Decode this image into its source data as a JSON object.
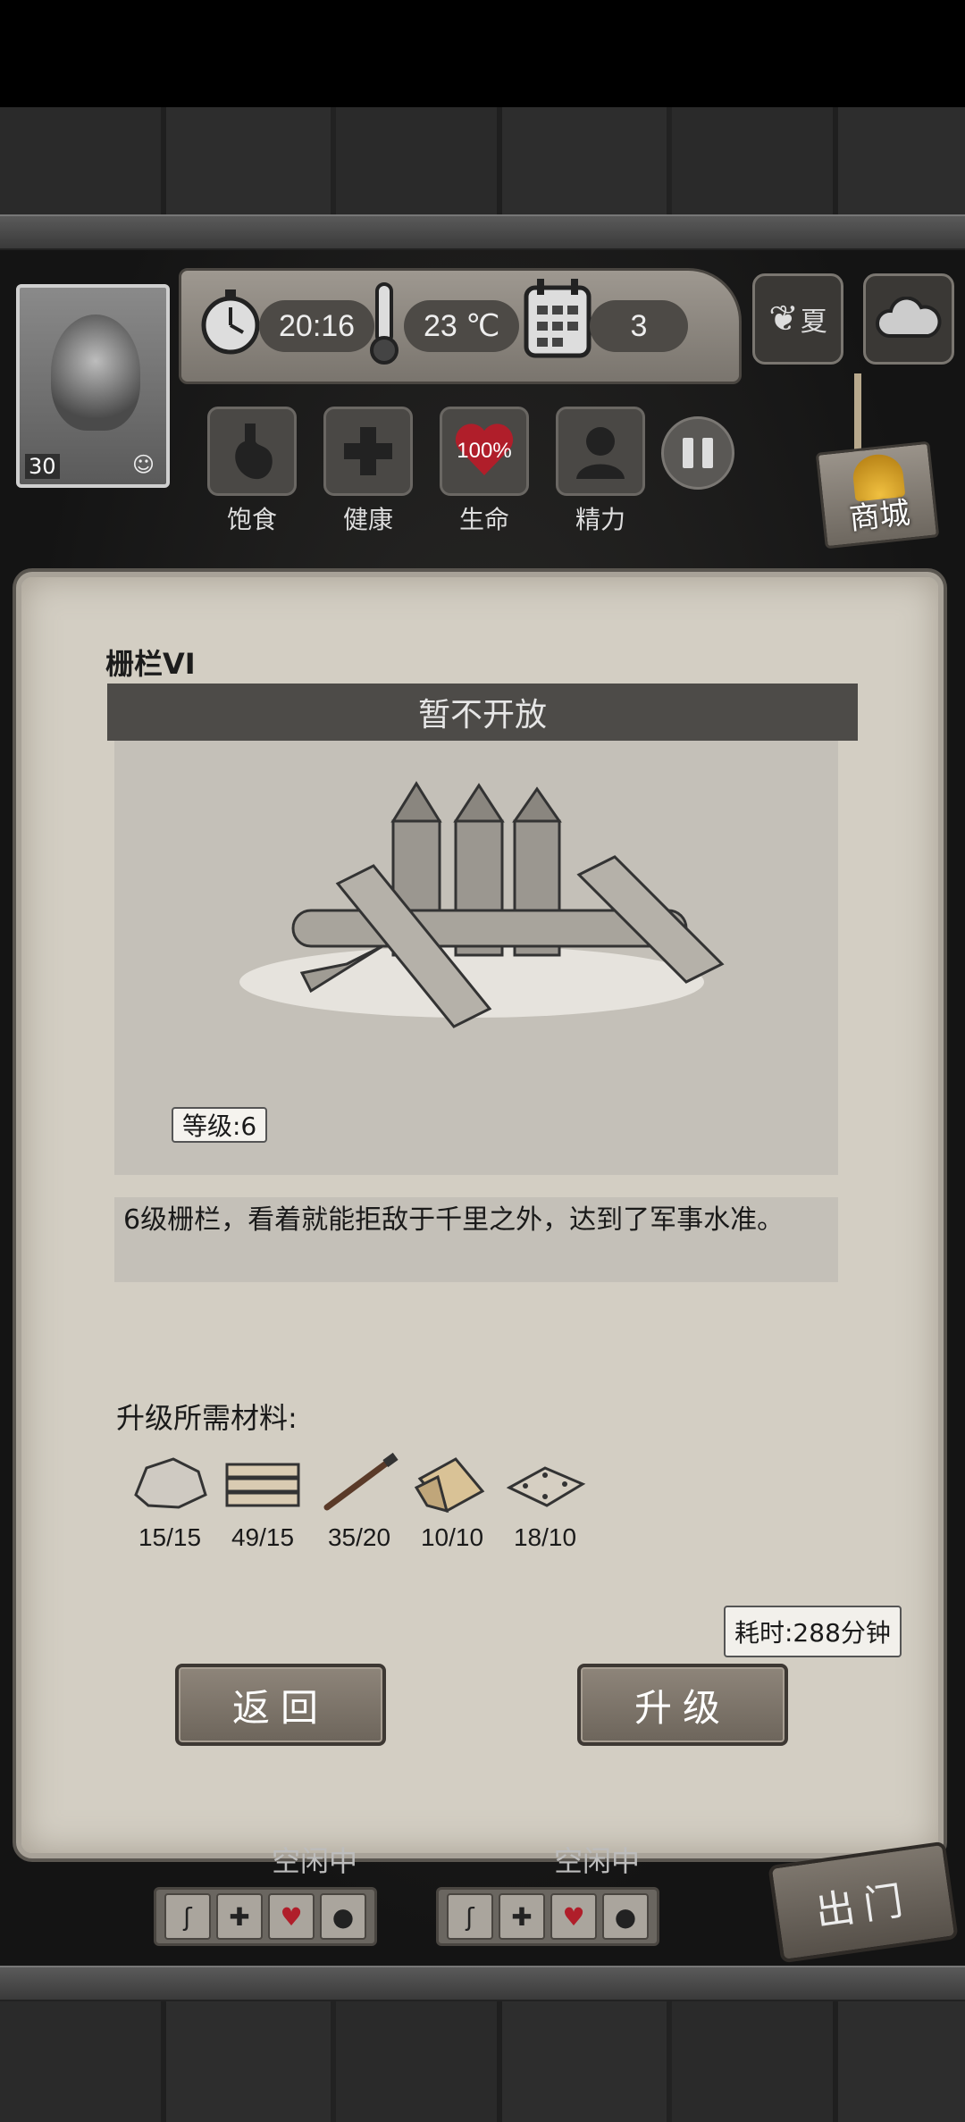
{
  "hud": {
    "clock": "20:16",
    "temperature": "23 ℃",
    "day": "3",
    "season": "夏",
    "avatar_level": "30"
  },
  "stats": [
    {
      "label": "饱食"
    },
    {
      "label": "健康"
    },
    {
      "label": "生命",
      "value": "100%"
    },
    {
      "label": "精力"
    }
  ],
  "shop": {
    "label": "商城"
  },
  "panel": {
    "title": "栅栏VI",
    "banner": "暂不开放",
    "level_tag": "等级:6",
    "description": "6级栅栏，看着就能拒敌于千里之外，达到了军事水准。",
    "materials_label": "升级所需材料:",
    "materials": [
      {
        "icon": "stone-icon",
        "count": "15/15"
      },
      {
        "icon": "plank-stack-icon",
        "count": "49/15"
      },
      {
        "icon": "nail-icon",
        "count": "35/20"
      },
      {
        "icon": "wood-board-icon",
        "count": "10/10"
      },
      {
        "icon": "wood-plate-icon",
        "count": "18/10"
      }
    ],
    "time_tip": "耗时:288分钟",
    "back_label": "返回",
    "upgrade_label": "升级"
  },
  "workers": [
    {
      "status": "空闲中"
    },
    {
      "status": "空闲中"
    }
  ],
  "exit_label": "出门",
  "colors": {
    "panel_bg": "#d3cec3",
    "banner_bg": "#4d4b48",
    "heart_red": "#b01e2a"
  }
}
